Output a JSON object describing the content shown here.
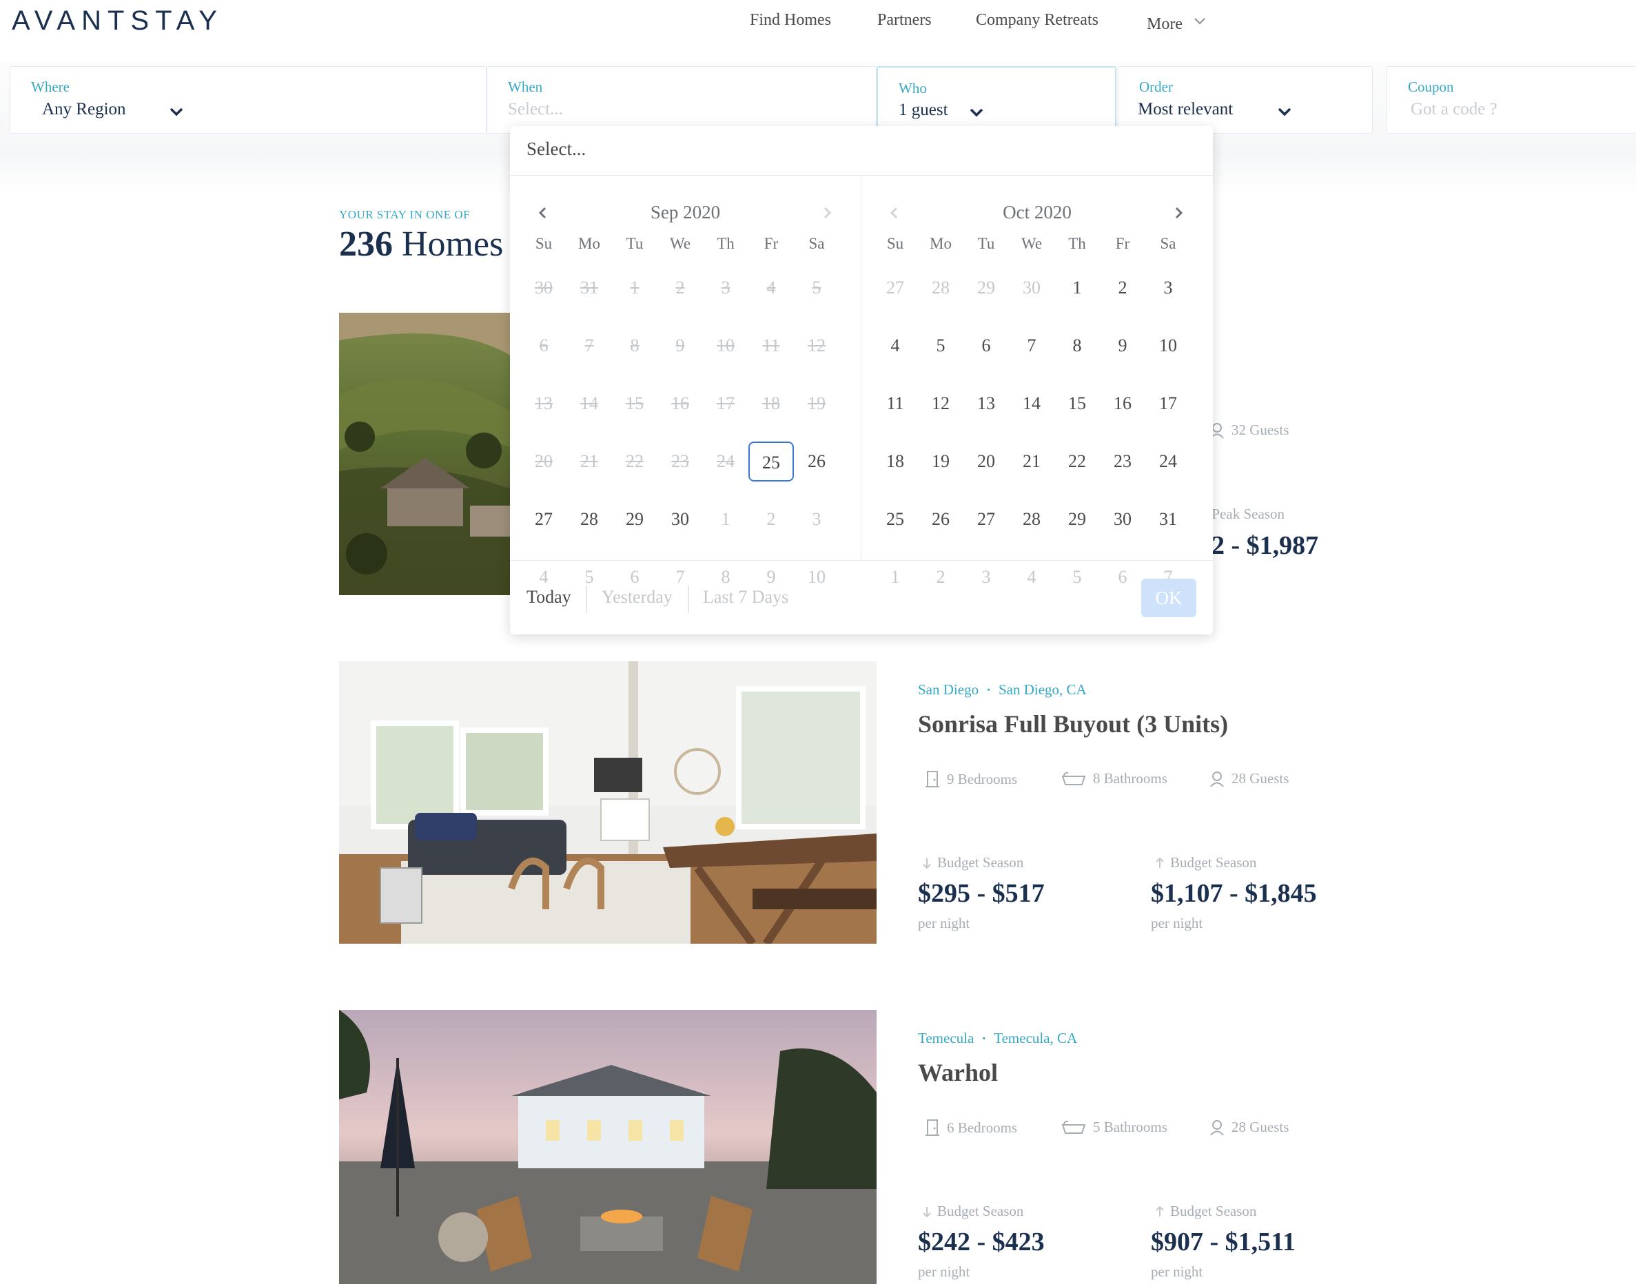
{
  "brand": "AVANTSTAY",
  "nav": {
    "find_homes": "Find Homes",
    "partners": "Partners",
    "company_retreats": "Company Retreats",
    "more": "More"
  },
  "filters": {
    "where": {
      "label": "Where",
      "value": "Any Region"
    },
    "when": {
      "label": "When",
      "placeholder": "Select..."
    },
    "who": {
      "label": "Who",
      "value": "1 guest"
    },
    "order": {
      "label": "Order",
      "value": "Most relevant"
    },
    "coupon": {
      "label": "Coupon",
      "placeholder": "Got a code ?"
    }
  },
  "results": {
    "eyebrow": "YOUR STAY IN ONE OF",
    "count": "236",
    "noun": "Homes"
  },
  "date_picker": {
    "header": "Select...",
    "left_month": "Sep 2020",
    "right_month": "Oct 2020",
    "weekdays": [
      "Su",
      "Mo",
      "Tu",
      "We",
      "Th",
      "Fr",
      "Sa"
    ],
    "left_weeks": [
      [
        "30",
        "31",
        "1",
        "2",
        "3",
        "4",
        "5"
      ],
      [
        "6",
        "7",
        "8",
        "9",
        "10",
        "11",
        "12"
      ],
      [
        "13",
        "14",
        "15",
        "16",
        "17",
        "18",
        "19"
      ],
      [
        "20",
        "21",
        "22",
        "23",
        "24",
        "25",
        "26"
      ],
      [
        "27",
        "28",
        "29",
        "30",
        "1",
        "2",
        "3"
      ],
      [
        "4",
        "5",
        "6",
        "7",
        "8",
        "9",
        "10"
      ]
    ],
    "right_weeks": [
      [
        "27",
        "28",
        "29",
        "30",
        "1",
        "2",
        "3"
      ],
      [
        "4",
        "5",
        "6",
        "7",
        "8",
        "9",
        "10"
      ],
      [
        "11",
        "12",
        "13",
        "14",
        "15",
        "16",
        "17"
      ],
      [
        "18",
        "19",
        "20",
        "21",
        "22",
        "23",
        "24"
      ],
      [
        "25",
        "26",
        "27",
        "28",
        "29",
        "30",
        "31"
      ],
      [
        "1",
        "2",
        "3",
        "4",
        "5",
        "6",
        "7"
      ]
    ],
    "ranges": {
      "today": "Today",
      "yesterday": "Yesterday",
      "last7": "Last 7 Days"
    },
    "ok": "OK",
    "selected_color": "#3a78d6"
  },
  "listings": [
    {
      "guests": "32 Guests",
      "season_label": "Peak Season",
      "price_peak": "2 - $1,987"
    },
    {
      "region": "San Diego",
      "city": "San Diego, CA",
      "title": "Sonrisa Full Buyout (3 Units)",
      "bedrooms": "9 Bedrooms",
      "bathrooms": "8 Bathrooms",
      "guests": "28 Guests",
      "budget_label": "Budget Season",
      "peak_label": "Budget Season",
      "price_low": "$295 - $517",
      "price_high": "$1,107 - $1,845",
      "per_night": "per night"
    },
    {
      "region": "Temecula",
      "city": "Temecula, CA",
      "title": "Warhol",
      "bedrooms": "6 Bedrooms",
      "bathrooms": "5 Bathrooms",
      "guests": "28 Guests",
      "budget_label": "Budget Season",
      "peak_label": "Budget Season",
      "price_low": "$242 - $423",
      "price_high": "$907 - $1,511",
      "per_night": "per night"
    }
  ],
  "colors": {
    "brand_navy": "#1b2f4e",
    "accent_teal": "#35a8c6"
  }
}
